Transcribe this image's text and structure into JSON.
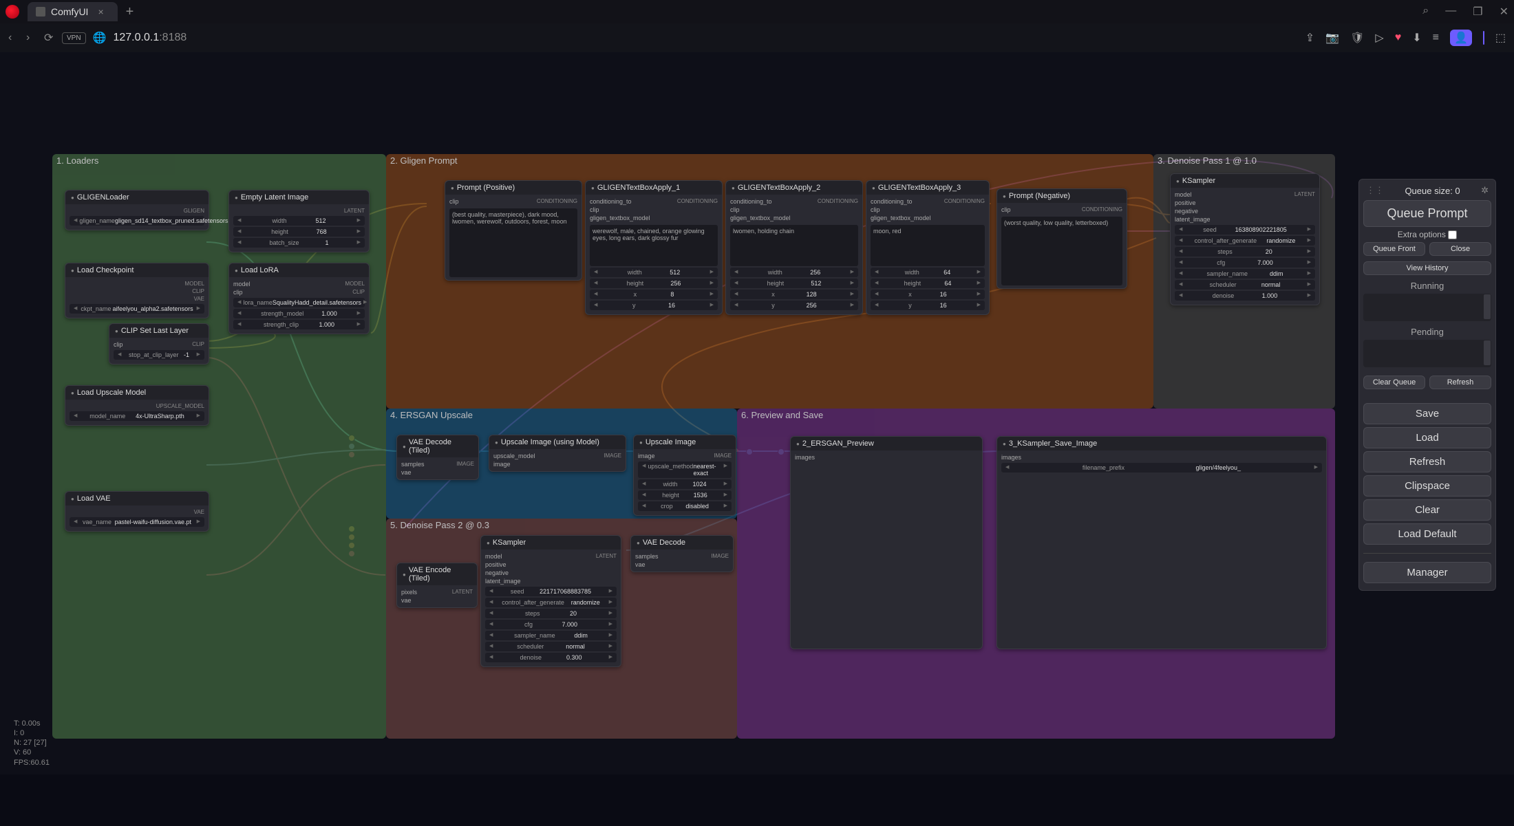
{
  "browser": {
    "tab_title": "ComfyUI",
    "url_host": "127.0.0.1",
    "url_port": ":8188",
    "vpn_label": "VPN"
  },
  "groups": {
    "loaders": "1. Loaders",
    "gligen": "2. Gligen Prompt",
    "denoise1": "3. Denoise Pass 1 @ 1.0",
    "ersgan": "4. ERSGAN Upscale",
    "denoise2": "5. Denoise Pass 2 @ 0.3",
    "preview": "6. Preview and Save"
  },
  "nodes": {
    "gligen_loader": {
      "title": "GLIGENLoader",
      "out_type": "GLIGEN",
      "param_key": "gligen_name",
      "param_val": "gligen_sd14_textbox_pruned.safetensors"
    },
    "empty_latent": {
      "title": "Empty Latent Image",
      "out_type": "LATENT",
      "p1k": "width",
      "p1v": "512",
      "p2k": "height",
      "p2v": "768",
      "p3k": "batch_size",
      "p3v": "1"
    },
    "load_ckpt": {
      "title": "Load Checkpoint",
      "out1": "MODEL",
      "out2": "CLIP",
      "out3": "VAE",
      "pk": "ckpt_name",
      "pv": "aifeelyou_alpha2.safetensors"
    },
    "load_lora": {
      "title": "Load LoRA",
      "in1": "model",
      "in2": "clip",
      "out1": "MODEL",
      "out2": "CLIP",
      "p1k": "lora_name",
      "p1v": "SqualityHadd_detail.safetensors",
      "p2k": "strength_model",
      "p2v": "1.000",
      "p3k": "strength_clip",
      "p3v": "1.000"
    },
    "clip_set": {
      "title": "CLIP Set Last Layer",
      "in1": "clip",
      "out1": "CLIP",
      "pk": "stop_at_clip_layer",
      "pv": "-1"
    },
    "load_upscale": {
      "title": "Load Upscale Model",
      "out_type": "UPSCALE_MODEL",
      "pk": "model_name",
      "pv": "4x-UltraSharp.pth"
    },
    "load_vae": {
      "title": "Load VAE",
      "out_type": "VAE",
      "pk": "vae_name",
      "pv": "pastel-waifu-diffusion.vae.pt"
    },
    "prompt_pos": {
      "title": "Prompt (Positive)",
      "in1": "clip",
      "out1": "CONDITIONING",
      "text": "(best quality, masterpiece), dark mood, lwomen, werewolf, outdoors, forest, moon"
    },
    "gligen_box1": {
      "title": "GLIGENTextBoxApply_1",
      "in1": "conditioning_to",
      "in2": "clip",
      "in3": "gligen_textbox_model",
      "out1": "CONDITIONING",
      "text": "werewolf, male, chained, orange glowing eyes, long ears, dark glossy fur",
      "p1k": "width",
      "p1v": "512",
      "p2k": "height",
      "p2v": "256",
      "p3k": "x",
      "p3v": "8",
      "p4k": "y",
      "p4v": "16"
    },
    "gligen_box2": {
      "title": "GLIGENTextBoxApply_2",
      "in1": "conditioning_to",
      "in2": "clip",
      "in3": "gligen_textbox_model",
      "out1": "CONDITIONING",
      "text": "lwomen, holding chain",
      "p1k": "width",
      "p1v": "256",
      "p2k": "height",
      "p2v": "512",
      "p3k": "x",
      "p3v": "128",
      "p4k": "y",
      "p4v": "256"
    },
    "gligen_box3": {
      "title": "GLIGENTextBoxApply_3",
      "in1": "conditioning_to",
      "in2": "clip",
      "in3": "gligen_textbox_model",
      "out1": "CONDITIONING",
      "text": "moon, red",
      "p1k": "width",
      "p1v": "64",
      "p2k": "height",
      "p2v": "64",
      "p3k": "x",
      "p3v": "16",
      "p4k": "y",
      "p4v": "16"
    },
    "prompt_neg": {
      "title": "Prompt (Negative)",
      "in1": "clip",
      "out1": "CONDITIONING",
      "text": "(worst quality, low quality, letterboxed)"
    },
    "ksampler1": {
      "title": "KSampler",
      "in1": "model",
      "in2": "positive",
      "in3": "negative",
      "in4": "latent_image",
      "out1": "LATENT",
      "p1k": "seed",
      "p1v": "163808902221805",
      "p2k": "control_after_generate",
      "p2v": "randomize",
      "p3k": "steps",
      "p3v": "20",
      "p4k": "cfg",
      "p4v": "7.000",
      "p5k": "sampler_name",
      "p5v": "ddim",
      "p6k": "scheduler",
      "p6v": "normal",
      "p7k": "denoise",
      "p7v": "1.000"
    },
    "vae_decode_tiled": {
      "title": "VAE Decode (Tiled)",
      "in1": "samples",
      "in2": "vae",
      "out1": "IMAGE"
    },
    "upscale_model": {
      "title": "Upscale Image (using Model)",
      "in1": "upscale_model",
      "in2": "image",
      "out1": "IMAGE"
    },
    "upscale_image": {
      "title": "Upscale Image",
      "in1": "image",
      "out1": "IMAGE",
      "p1k": "upscale_method",
      "p1v": "nearest-exact",
      "p2k": "width",
      "p2v": "1024",
      "p3k": "height",
      "p3v": "1536",
      "p4k": "crop",
      "p4v": "disabled"
    },
    "vae_encode_tiled": {
      "title": "VAE Encode (Tiled)",
      "in1": "pixels",
      "in2": "vae",
      "out1": "LATENT"
    },
    "ksampler2": {
      "title": "KSampler",
      "in1": "model",
      "in2": "positive",
      "in3": "negative",
      "in4": "latent_image",
      "out1": "LATENT",
      "p1k": "seed",
      "p1v": "221717068883785",
      "p2k": "control_after_generate",
      "p2v": "randomize",
      "p3k": "steps",
      "p3v": "20",
      "p4k": "cfg",
      "p4v": "7.000",
      "p5k": "sampler_name",
      "p5v": "ddim",
      "p6k": "scheduler",
      "p6v": "normal",
      "p7k": "denoise",
      "p7v": "0.300"
    },
    "vae_decode": {
      "title": "VAE Decode",
      "in1": "samples",
      "in2": "vae",
      "out1": "IMAGE"
    },
    "preview": {
      "title": "2_ERSGAN_Preview",
      "in1": "images"
    },
    "save_image": {
      "title": "3_KSampler_Save_Image",
      "in1": "images",
      "pk": "filename_prefix",
      "pv": "gligen/4feelyou_"
    }
  },
  "sidepanel": {
    "queue_size_label": "Queue size: 0",
    "queue_prompt": "Queue Prompt",
    "extra_options": "Extra options",
    "queue_front": "Queue Front",
    "close": "Close",
    "view_history": "View History",
    "running": "Running",
    "pending": "Pending",
    "clear_queue": "Clear Queue",
    "refresh_queue": "Refresh",
    "save": "Save",
    "load": "Load",
    "refresh": "Refresh",
    "clipspace": "Clipspace",
    "clear": "Clear",
    "load_default": "Load Default",
    "manager": "Manager"
  },
  "stats": {
    "l1": "T: 0.00s",
    "l2": "I: 0",
    "l3": "N: 27 [27]",
    "l4": "V: 60",
    "l5": "FPS:60.61"
  }
}
